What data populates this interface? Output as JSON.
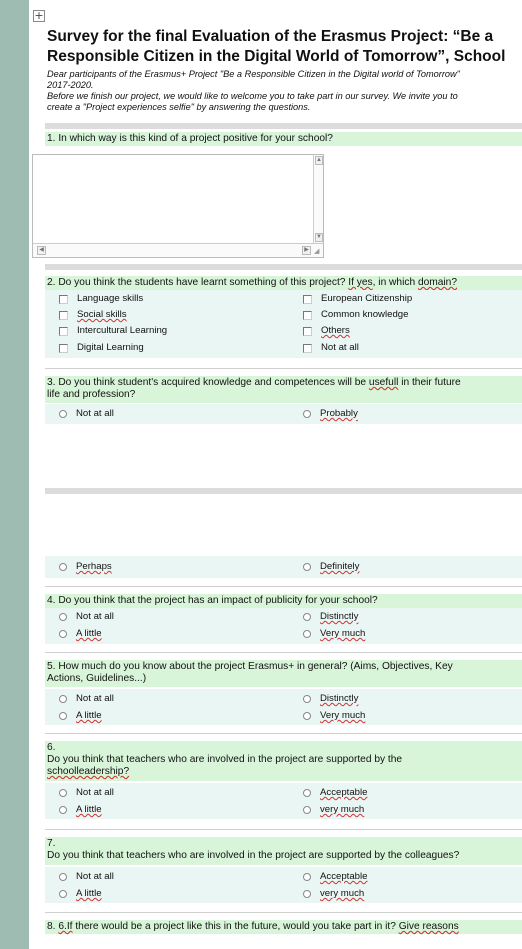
{
  "title_line1": "Survey for the final Evaluation of the Erasmus Project: “Be a",
  "title_line2": "Responsible Citizen in the Digital World of Tomorrow”, School",
  "intro_line1": "Dear participants of the Erasmus+ Project \"Be a Responsible Citizen in the Digital world of Tomorrow\"",
  "intro_line2": "2017-2020.",
  "intro_line3": "Before we finish our project, we would like to welcome you to take part in our survey. We invite you to",
  "intro_line4": "create a \"Project experiences selfie\" by answering the questions.",
  "q1": {
    "text": "1. In which way is this kind of a project positive for your school?"
  },
  "q2": {
    "text_a": "2. Do you think the students have learnt something of this project? ",
    "text_b": "If yes",
    "text_c": ", in which ",
    "text_d": "domain?",
    "options": [
      "Language skills",
      "European Citizenship",
      "Social skills",
      "Common knowledge",
      "Intercultural Learning",
      "Others",
      "Digital Learning",
      "Not at all"
    ]
  },
  "q3": {
    "text_a": "3. Do you think student's acquired knowledge and competences will be ",
    "text_b": "usefull",
    "text_c": " in their future",
    "text_line2": "life and profession?",
    "options": [
      "Not at all",
      "Probably",
      "Perhaps",
      "Definitely"
    ]
  },
  "q4": {
    "text": "4. Do you think that the project has an impact of publicity for your school?",
    "options": [
      "Not at all",
      "Distinctly",
      "A little",
      "Very much"
    ]
  },
  "q5": {
    "text_line1": "5. How much do you know about the project Erasmus+ in general? (Aims, Objectives, Key",
    "text_line2": "Actions, Guidelines...)",
    "options": [
      "Not at all",
      "Distinctly",
      "A little",
      "Very much"
    ]
  },
  "q6": {
    "num": "6.",
    "text_line1": "Do you think that teachers who are involved in the project are supported by the",
    "text_line2": "schoolleadership?",
    "options": [
      "Not at all",
      "Acceptable",
      "A little",
      "very much"
    ]
  },
  "q7": {
    "num": "7.",
    "text_line1": "Do you think that teachers who are involved in the project are supported by the colleagues?",
    "options": [
      "Not at all",
      "Acceptable",
      "A little",
      "very much"
    ]
  },
  "q8": {
    "text_a": "8. ",
    "text_b": "6.If",
    "text_c": " there would be a project like this in the future, would you take part in it? ",
    "text_d": "Give reasons"
  }
}
